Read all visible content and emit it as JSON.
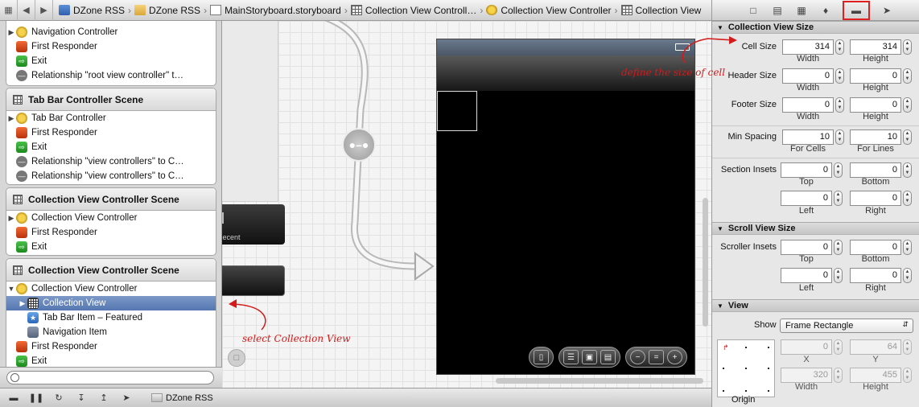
{
  "breadcrumbs": [
    "DZone RSS",
    "DZone RSS",
    "MainStoryboard.storyboard",
    "Collection View Controll…",
    "Collection View Controller",
    "Collection View"
  ],
  "outline": {
    "scenes": [
      {
        "title": "",
        "items": [
          {
            "label": "Navigation Controller",
            "icon": "navigation-controller-icon"
          },
          {
            "label": "First Responder",
            "icon": "first-responder-icon"
          },
          {
            "label": "Exit",
            "icon": "exit-icon"
          },
          {
            "label": "Relationship \"root view controller\" t…",
            "icon": "relationship-icon"
          }
        ]
      },
      {
        "title": "Tab Bar Controller Scene",
        "items": [
          {
            "label": "Tab Bar Controller",
            "icon": "tab-bar-controller-icon"
          },
          {
            "label": "First Responder",
            "icon": "first-responder-icon"
          },
          {
            "label": "Exit",
            "icon": "exit-icon"
          },
          {
            "label": "Relationship \"view controllers\" to C…",
            "icon": "relationship-icon"
          },
          {
            "label": "Relationship \"view controllers\" to C…",
            "icon": "relationship-icon"
          }
        ]
      },
      {
        "title": "Collection View Controller Scene",
        "items": [
          {
            "label": "Collection View Controller",
            "icon": "view-controller-icon"
          },
          {
            "label": "First Responder",
            "icon": "first-responder-icon"
          },
          {
            "label": "Exit",
            "icon": "exit-icon"
          }
        ]
      },
      {
        "title": "Collection View Controller Scene",
        "items": [
          {
            "label": "Collection View Controller",
            "icon": "view-controller-icon"
          },
          {
            "label": "Collection View",
            "icon": "collection-view-icon",
            "selected": true
          },
          {
            "label": "Tab Bar Item – Featured",
            "icon": "tab-bar-item-icon"
          },
          {
            "label": "Navigation Item",
            "icon": "navigation-item-icon"
          },
          {
            "label": "First Responder",
            "icon": "first-responder-icon"
          },
          {
            "label": "Exit",
            "icon": "exit-icon"
          }
        ]
      }
    ]
  },
  "canvas": {
    "prev_tab_label": "Recent"
  },
  "debugbar": {
    "target": "DZone RSS"
  },
  "inspector": {
    "collection_view_size": {
      "title": "Collection View Size",
      "cell_size": {
        "label": "Cell Size",
        "width": "314",
        "height": "314",
        "width_label": "Width",
        "height_label": "Height"
      },
      "header_size": {
        "label": "Header Size",
        "width": "0",
        "height": "0",
        "width_label": "Width",
        "height_label": "Height"
      },
      "footer_size": {
        "label": "Footer Size",
        "width": "0",
        "height": "0",
        "width_label": "Width",
        "height_label": "Height"
      },
      "min_spacing": {
        "label": "Min Spacing",
        "cells": "10",
        "lines": "10",
        "cells_label": "For Cells",
        "lines_label": "For Lines"
      },
      "section_insets": {
        "label": "Section Insets",
        "top": "0",
        "bottom": "0",
        "left": "0",
        "right": "0",
        "top_label": "Top",
        "bottom_label": "Bottom",
        "left_label": "Left",
        "right_label": "Right"
      }
    },
    "scroll_view_size": {
      "title": "Scroll View Size",
      "scroller_insets": {
        "label": "Scroller Insets",
        "top": "0",
        "bottom": "0",
        "left": "0",
        "right": "0",
        "top_label": "Top",
        "bottom_label": "Bottom",
        "left_label": "Left",
        "right_label": "Right"
      }
    },
    "view": {
      "title": "View",
      "show_label": "Show",
      "show_value": "Frame Rectangle",
      "x": "0",
      "y": "64",
      "width": "320",
      "height": "455",
      "x_label": "X",
      "y_label": "Y",
      "width_label": "Width",
      "height_label": "Height",
      "origin_label": "Origin"
    }
  },
  "annotations": {
    "cell_note": "define the size of cell",
    "select_note": "select Collection View",
    "color": "#d21b1b"
  }
}
